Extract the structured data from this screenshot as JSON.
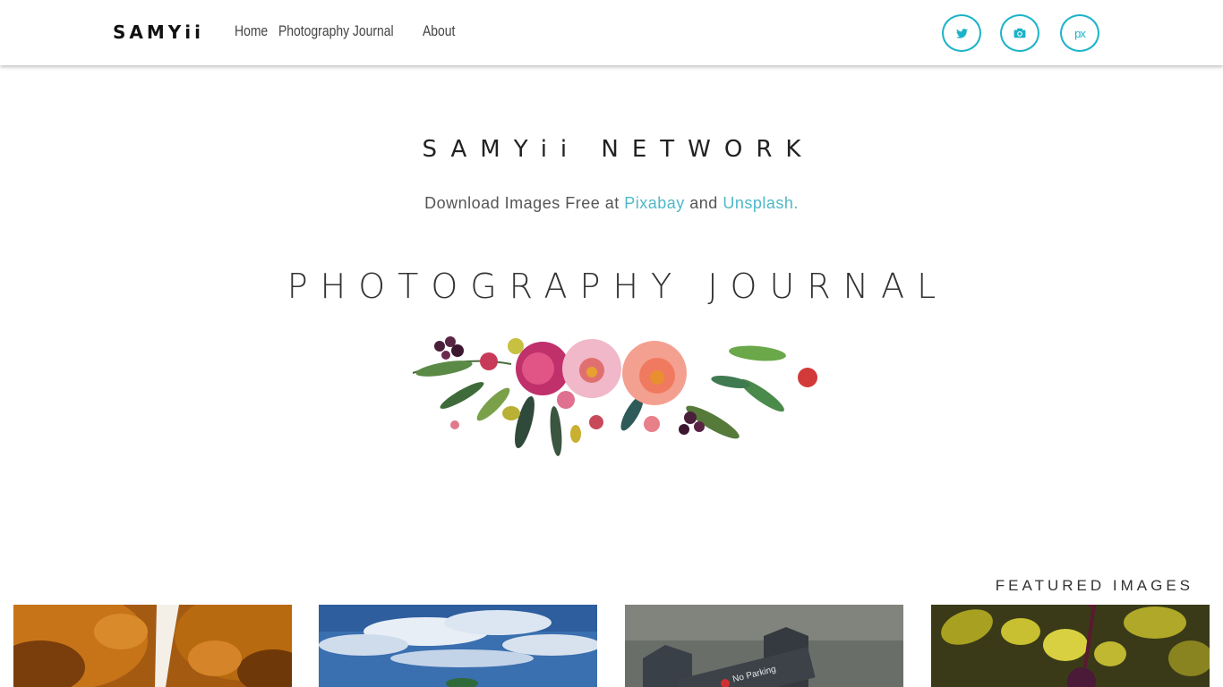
{
  "nav": {
    "brand": "SAMYii",
    "links": [
      "Home",
      "Photography Journal",
      "About"
    ],
    "social": [
      {
        "icon": "twitter-icon",
        "glyph": "🐦"
      },
      {
        "icon": "camera-icon",
        "glyph": "📷"
      },
      {
        "icon": "500px-icon",
        "glyph": "px"
      }
    ]
  },
  "hero": {
    "site_title": "SAMYii NETWORK",
    "tagline_prefix": "Download Images Free at ",
    "tagline_link1": "Pixabay",
    "tagline_mid": " and ",
    "tagline_link2": "Unsplash.",
    "heading": "PHOTOGRAPHY JOURNAL"
  },
  "featured": {
    "label": "FEATURED IMAGES",
    "images": [
      {
        "name": "autumn-trees-image"
      },
      {
        "name": "blue-sky-clouds-image"
      },
      {
        "name": "no-parking-sign-image"
      },
      {
        "name": "rose-hip-leaves-image"
      }
    ]
  },
  "colors": {
    "accent": "#1ab3c8",
    "link": "#4fb8c8"
  }
}
